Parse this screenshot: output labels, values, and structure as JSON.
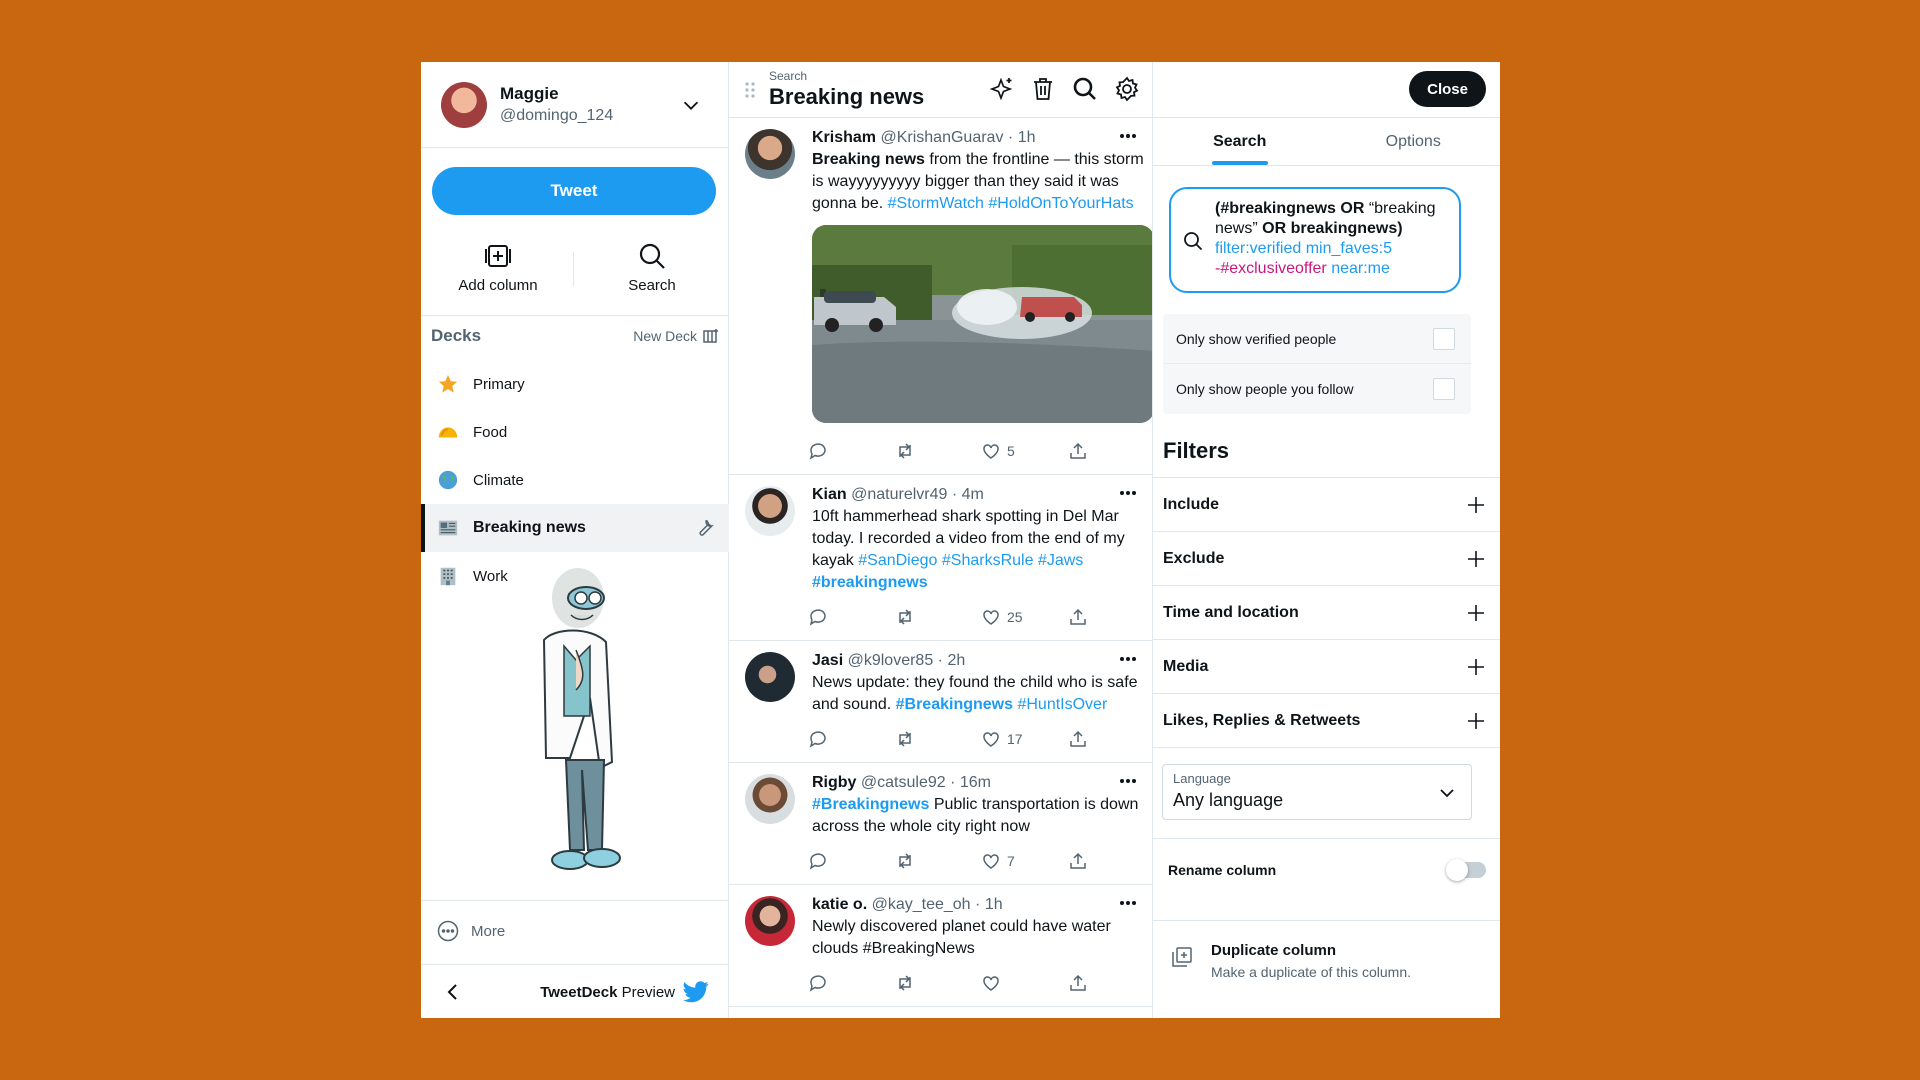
{
  "account": {
    "name": "Maggie",
    "handle": "@domingo_124"
  },
  "sidebar": {
    "tweet_label": "Tweet",
    "add_column_label": "Add column",
    "search_label": "Search",
    "decks_title": "Decks",
    "new_deck_label": "New Deck",
    "decks": [
      {
        "label": "Primary",
        "icon": "star-icon"
      },
      {
        "label": "Food",
        "icon": "taco-icon"
      },
      {
        "label": "Climate",
        "icon": "globe-icon"
      },
      {
        "label": "Breaking news",
        "icon": "newspaper-icon"
      },
      {
        "label": "Work",
        "icon": "office-building-icon"
      }
    ],
    "more_label": "More",
    "footer_brand": "TweetDeck",
    "footer_suffix": "Preview"
  },
  "column": {
    "subtitle": "Search",
    "title": "Breaking news",
    "tweets": [
      {
        "name": "Krisham",
        "handle": "@KrishanGuarav",
        "time": "1h",
        "text_bold": "Breaking news",
        "text": " from the frontline — this storm is wayyyyyyyyy bigger than they said it was gonna be. ",
        "tags": "#StormWatch #HoldOnToYourHats",
        "likes": "5",
        "has_media": true
      },
      {
        "name": "Kian",
        "handle": "@naturelvr49",
        "time": "4m",
        "text": "10ft hammerhead shark spotting in Del Mar today. I recorded a video from the end of my kayak ",
        "tags": "#SanDiego #SharksRule #Jaws",
        "bold_tag": "#breakingnews",
        "likes": "25"
      },
      {
        "name": "Jasi",
        "handle": "@k9lover85",
        "time": "2h",
        "text": "News update: they found the child who is safe and sound. ",
        "bold_tag": "#Breakingnews",
        "tags": "#HuntIsOver",
        "likes": "17"
      },
      {
        "name": "Rigby",
        "handle": "@catsule92",
        "time": "16m",
        "bold_tag": "#Breakingnews",
        "text": " Public transportation is down across the whole city right now",
        "likes": "7"
      },
      {
        "name": "katie o.",
        "handle": "@kay_tee_oh",
        "time": "1h",
        "text": "Newly discovered planet could have water clouds #BreakingNews",
        "likes": ""
      }
    ]
  },
  "panel": {
    "close_label": "Close",
    "tabs": [
      "Search",
      "Options"
    ],
    "query": {
      "p1": "(#breakingnews ",
      "or1": "OR",
      "p2": " “breaking news” ",
      "or2": "OR",
      "p3": " breakingnews)",
      "blue1": "filter:verified min_faves:5",
      "pink": "-#exclusiveoffer",
      "blue2": " near:me"
    },
    "checks": [
      "Only show verified people",
      "Only show people you follow"
    ],
    "filters_title": "Filters",
    "filters": [
      "Include",
      "Exclude",
      "Time and location",
      "Media",
      "Likes, Replies & Retweets"
    ],
    "language_label": "Language",
    "language_value": "Any language",
    "rename_label": "Rename column",
    "duplicate_title": "Duplicate column",
    "duplicate_desc": "Make a duplicate of this column."
  },
  "colors": {
    "accent": "#1d9bf0",
    "background": "#c8670f",
    "pink": "#c9177e"
  }
}
